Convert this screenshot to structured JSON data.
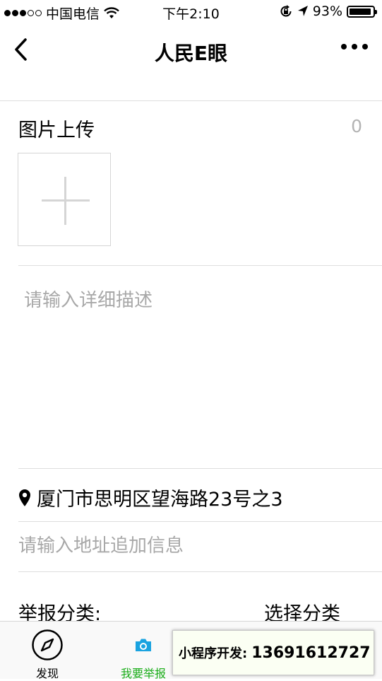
{
  "status_bar": {
    "carrier": "中国电信",
    "time": "下午2:10",
    "battery_percent": "93%",
    "battery_level": 0.93,
    "signal_dots_filled": 3,
    "signal_dots_total": 5
  },
  "nav": {
    "title": "人民E眼",
    "back_icon": "chevron-left-icon",
    "more_icon": "more-dots-icon"
  },
  "upload": {
    "label": "图片上传",
    "count": "0"
  },
  "description": {
    "placeholder": "请输入详细描述",
    "value": ""
  },
  "location": {
    "icon": "map-pin-icon",
    "address": "厦门市思明区望海路23号之3"
  },
  "address_extra": {
    "placeholder": "请输入地址追加信息",
    "value": ""
  },
  "category": {
    "label": "举报分类:",
    "select_label": "选择分类"
  },
  "tabbar": {
    "tabs": [
      {
        "label": "发现",
        "icon": "compass-icon",
        "active": false
      },
      {
        "label": "我要举报",
        "icon": "camera-icon",
        "active": true
      }
    ],
    "active_color": "#1aad19"
  },
  "ad": {
    "label": "小程序开发:",
    "phone": "13691612727"
  }
}
